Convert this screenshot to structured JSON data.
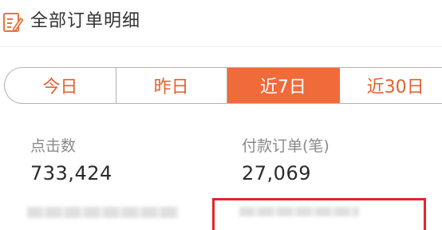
{
  "header": {
    "icon": "edit-document-icon",
    "title": "全部订单明细"
  },
  "tabs": [
    {
      "label": "今日",
      "active": false
    },
    {
      "label": "昨日",
      "active": false
    },
    {
      "label": "近7日",
      "active": true
    },
    {
      "label": "近30日",
      "active": false
    }
  ],
  "stats": {
    "clicks": {
      "label": "点击数",
      "value": "733,424"
    },
    "paid_orders": {
      "label": "付款订单(笔)",
      "value": "27,069"
    }
  },
  "colors": {
    "accent": "#f06a3a",
    "tab_text": "#e4612f",
    "highlight_box": "#e0262b"
  }
}
